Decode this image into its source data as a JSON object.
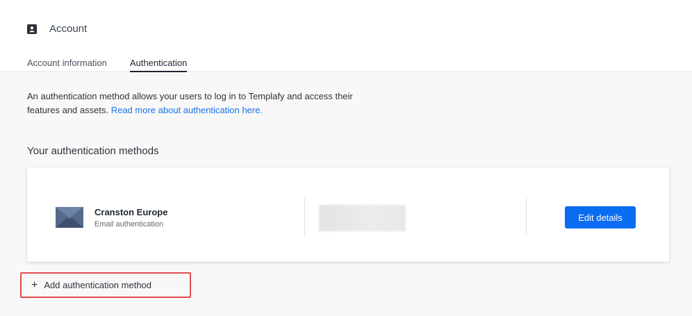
{
  "header": {
    "title": "Account",
    "tabs": [
      {
        "label": "Account information",
        "active": false
      },
      {
        "label": "Authentication",
        "active": true
      }
    ]
  },
  "main": {
    "description": "An authentication method allows your users to log in to Templafy and access their features and assets.",
    "description_link": "Read more about authentication here.",
    "section_title": "Your authentication methods",
    "methods": [
      {
        "name": "Cranston Europe",
        "type": "Email authentication",
        "icon": "envelope-icon",
        "action_label": "Edit details"
      }
    ],
    "add_label": "Add authentication method"
  },
  "colors": {
    "accent": "#0a6cf0",
    "link": "#1a73e8",
    "highlight_border": "#e14b4b"
  }
}
